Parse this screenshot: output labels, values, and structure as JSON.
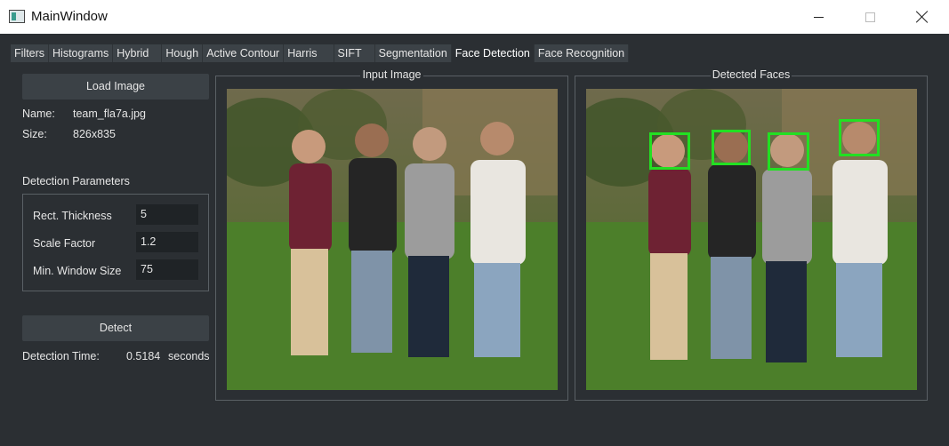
{
  "window": {
    "title": "MainWindow"
  },
  "tabs": [
    {
      "label": "Filters",
      "active": false
    },
    {
      "label": "Histograms",
      "active": false
    },
    {
      "label": "Hybrid",
      "active": false
    },
    {
      "label": "Hough",
      "active": false
    },
    {
      "label": "Active Contour",
      "active": false
    },
    {
      "label": "Harris",
      "active": false
    },
    {
      "label": "SIFT",
      "active": false
    },
    {
      "label": "Segmentation",
      "active": false
    },
    {
      "label": "Face Detection",
      "active": true
    },
    {
      "label": "Face Recognition",
      "active": false
    }
  ],
  "left_panel": {
    "load_button": "Load Image",
    "name_label": "Name:",
    "name_value": "team_fla7a.jpg",
    "size_label": "Size:",
    "size_value": "826x835",
    "params_title": "Detection Parameters",
    "params": [
      {
        "label": "Rect. Thickness",
        "value": "5"
      },
      {
        "label": "Scale Factor",
        "value": "1.2"
      },
      {
        "label": "Min. Window Size",
        "value": "75"
      }
    ],
    "detect_button": "Detect",
    "time_label": "Detection Time:",
    "time_value": "0.5184",
    "time_unit": "seconds"
  },
  "input_group": {
    "title": "Input Image"
  },
  "output_group": {
    "title": "Detected Faces"
  },
  "colors": {
    "face_box": "#22e022",
    "background": "#2b2f33"
  }
}
